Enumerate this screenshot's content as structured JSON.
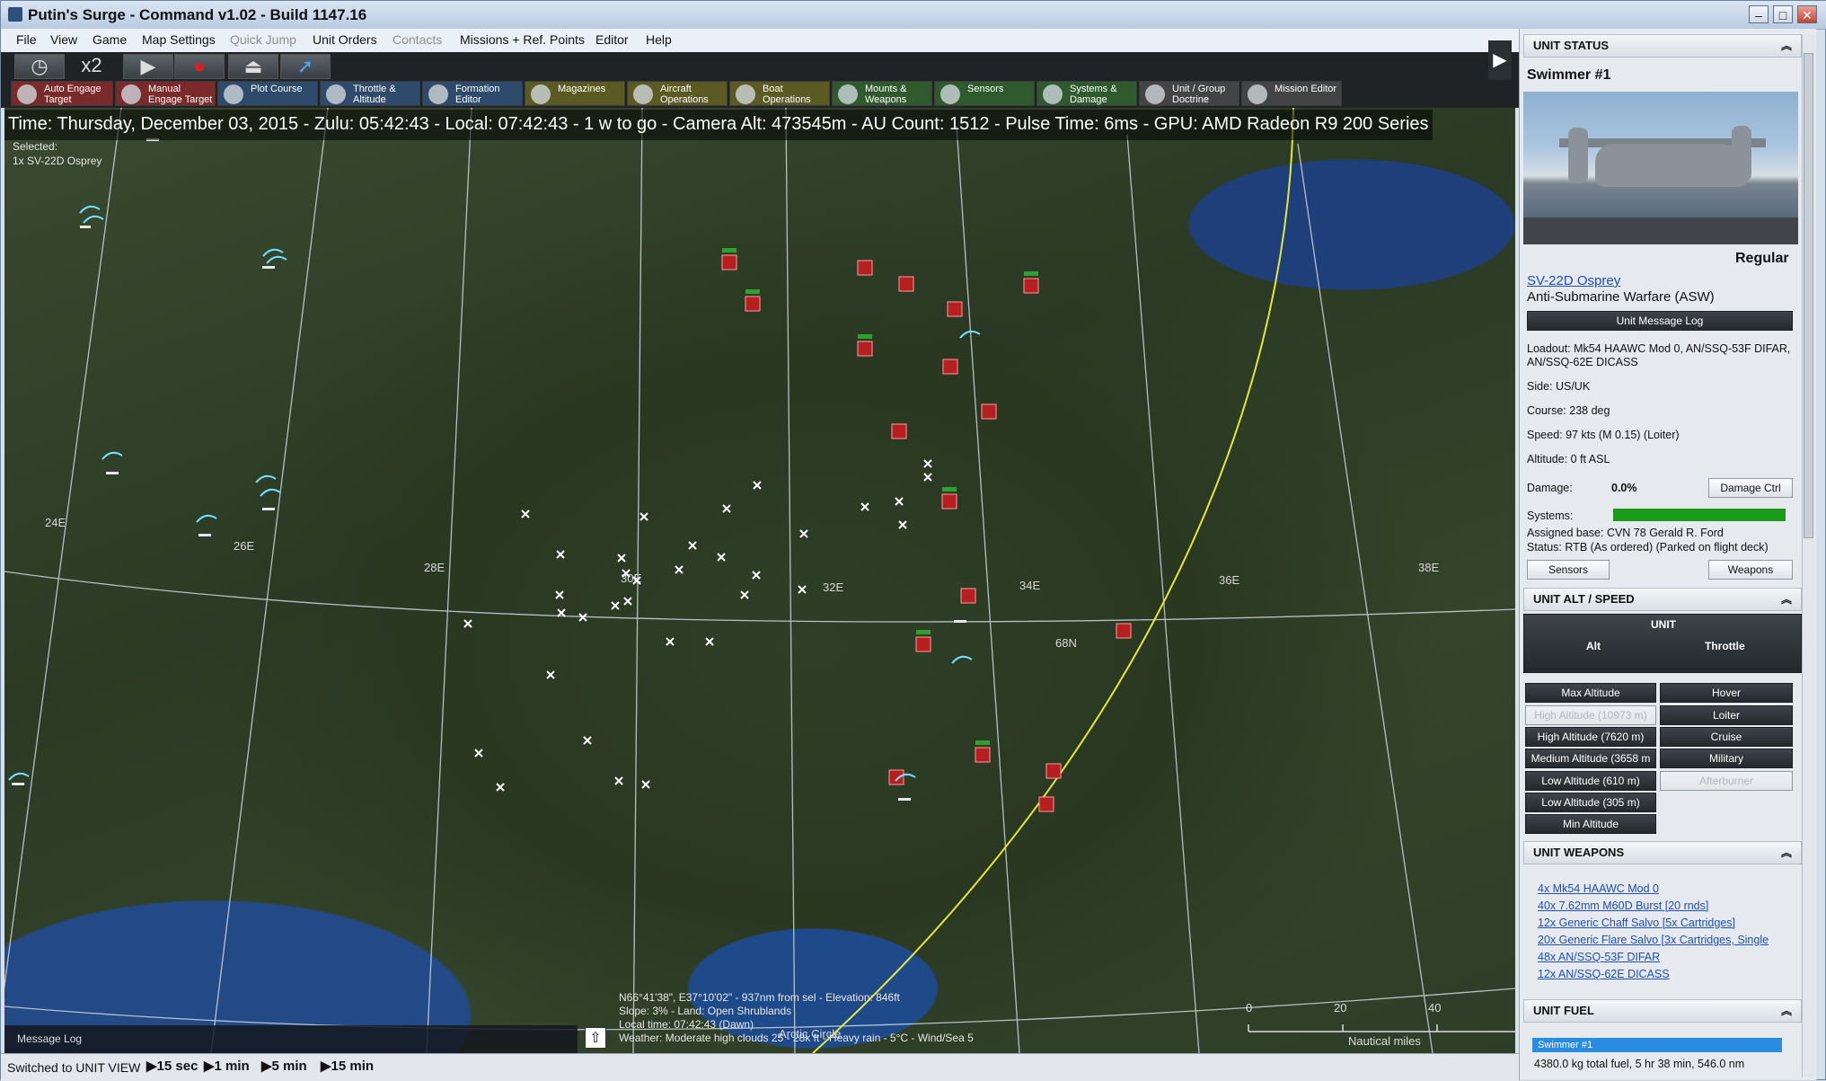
{
  "window": {
    "title": "Putin's Surge - Command v1.02 - Build 1147.16"
  },
  "menu": [
    "File",
    "View",
    "Game",
    "Map Settings",
    "Quick Jump",
    "Unit Orders",
    "Contacts",
    "Missions + Ref. Points",
    "Editor",
    "Help"
  ],
  "toolbar": {
    "time_compression": "x2",
    "tools": [
      {
        "label": "Auto Engage Target",
        "color": "#7a2a2a"
      },
      {
        "label": "Manual Engage Target",
        "color": "#7a2a2a"
      },
      {
        "label": "Plot Course",
        "color": "#2f4b6b"
      },
      {
        "label": "Throttle & Altitude",
        "color": "#2f4b6b"
      },
      {
        "label": "Formation Editor",
        "color": "#2f4b6b"
      },
      {
        "label": "Magazines",
        "color": "#5a5a22"
      },
      {
        "label": "Aircraft Operations",
        "color": "#5a5a22"
      },
      {
        "label": "Boat Operations",
        "color": "#5a5a22"
      },
      {
        "label": "Mounts & Weapons",
        "color": "#2e5a2e"
      },
      {
        "label": "Sensors",
        "color": "#2e5a2e"
      },
      {
        "label": "Systems & Damage",
        "color": "#2e5a2e"
      },
      {
        "label": "Unit / Group Doctrine",
        "color": "#444"
      },
      {
        "label": "Mission Editor",
        "color": "#444"
      }
    ]
  },
  "map": {
    "info": "Time: Thursday, December 03, 2015 - Zulu: 05:42:43 - Local: 07:42:43 - 1 w to go - Camera Alt: 473545m - AU Count: 1512 - Pulse Time: 6ms - GPU: AMD Radeon R9 200 Series",
    "selected_label": "Selected:",
    "selected_unit": "1x SV-22D Osprey",
    "longitudes": [
      "24E",
      "26E",
      "28E",
      "30E",
      "32E",
      "34E",
      "36E",
      "38E"
    ],
    "latitude": "68N",
    "arctic": "Arctic Circle",
    "cursor_info": [
      "N66°41'38\", E37°10'02\" - 937nm from sel - Elevation: 846ft",
      "Slope: 3%  - Land: Open Shrublands",
      "Local time: 07:42:43 (Dawn)",
      "Weather: Moderate high clouds 25 - 28k ft - Heavy rain - 5°C - Wind/Sea 5"
    ],
    "scale": {
      "t0": "0",
      "t1": "20",
      "t2": "40",
      "unit": "Nautical miles"
    },
    "message_log": "Message Log"
  },
  "statusbar": {
    "view": "Switched to UNIT VIEW",
    "steps": [
      "15 sec",
      "1 min",
      "5 min",
      "15 min"
    ]
  },
  "panel": {
    "unit_status_header": "UNIT STATUS",
    "unit_name": "Swimmer #1",
    "proficiency": "Regular",
    "type": "SV-22D Osprey",
    "role": "Anti-Submarine Warfare (ASW)",
    "message_log_btn": "Unit Message Log",
    "loadout": "Loadout: Mk54 HAAWC Mod 0, AN/SSQ-53F DIFAR, AN/SSQ-62E DICASS",
    "side": "Side: US/UK",
    "course": "Course: 238 deg",
    "speed": "Speed: 97 kts (M 0.15) (Loiter)",
    "altitude": "Altitude: 0 ft ASL",
    "damage_label": "Damage:",
    "damage_value": "0.0%",
    "damage_btn": "Damage Ctrl",
    "systems_label": "Systems:",
    "systems_health": 1.0,
    "base": "Assigned base: CVN 78 Gerald R. Ford",
    "status": "Status: RTB (As ordered) (Parked on flight deck)",
    "sensors_btn": "Sensors",
    "weapons_btn": "Weapons",
    "alt_speed_header": "UNIT ALT / SPEED",
    "unit_label": "UNIT",
    "alt_col": "Alt",
    "throttle_col": "Throttle",
    "altitudes": [
      "Max Altitude",
      "High Altitude (10973 m)",
      "High Altitude (7620 m)",
      "Medium Altitude (3658 m",
      "Low Altitude (610 m)",
      "Low Altitude (305 m)",
      "Min Altitude"
    ],
    "throttles": [
      "Hover",
      "Loiter",
      "Cruise",
      "Military",
      "Afterburner"
    ],
    "weapons_header": "UNIT WEAPONS",
    "weapons": [
      "4x Mk54 HAAWC Mod 0",
      "40x 7.62mm M60D Burst [20 rnds]",
      "12x Generic Chaff Salvo [5x Cartridges]",
      "20x Generic Flare Salvo [3x Cartridges, Single",
      "48x AN/SSQ-53F DIFAR",
      "12x AN/SSQ-62E DICASS"
    ],
    "fuel_header": "UNIT FUEL",
    "fuel_item": "Swimmer #1",
    "fuel_text": "4380.0 kg total fuel, 5 hr 38 min, 546.0 nm"
  }
}
